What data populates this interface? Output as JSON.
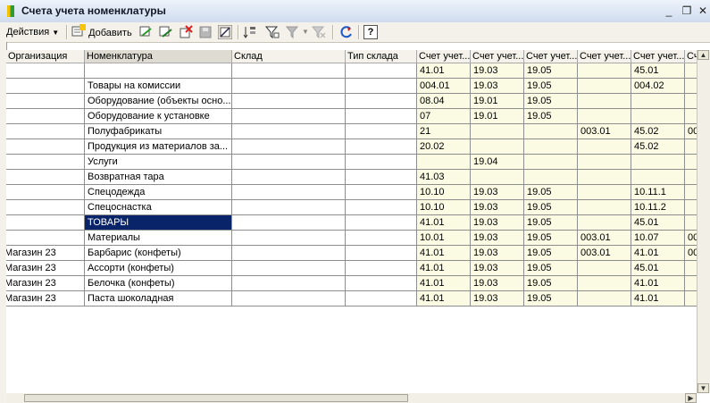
{
  "window": {
    "title": "Счета учета номенклатуры",
    "minimize": "_",
    "restore": "❐",
    "close": "✕"
  },
  "toolbar": {
    "actions_label": "Действия",
    "add_label": "Добавить",
    "help_label": "?"
  },
  "columns": [
    "Организация",
    "Номенклатура",
    "Склад",
    "Тип склада",
    "Счет учет...",
    "Счет учет...",
    "Счет учет...",
    "Счет учет...",
    "Счет учет...",
    "Сч"
  ],
  "rows": [
    [
      "",
      "",
      "",
      "",
      "41.01",
      "19.03",
      "19.05",
      "",
      "45.01",
      ""
    ],
    [
      "",
      "Товары на комиссии",
      "",
      "",
      "004.01",
      "19.03",
      "19.05",
      "",
      "004.02",
      ""
    ],
    [
      "",
      "Оборудование (объекты осно...",
      "",
      "",
      "08.04",
      "19.01",
      "19.05",
      "",
      "",
      ""
    ],
    [
      "",
      "Оборудование к установке",
      "",
      "",
      "07",
      "19.01",
      "19.05",
      "",
      "",
      ""
    ],
    [
      "",
      "Полуфабрикаты",
      "",
      "",
      "21",
      "",
      "",
      "003.01",
      "45.02",
      "00"
    ],
    [
      "",
      "Продукция из материалов за...",
      "",
      "",
      "20.02",
      "",
      "",
      "",
      "45.02",
      ""
    ],
    [
      "",
      "Услуги",
      "",
      "",
      "",
      "19.04",
      "",
      "",
      "",
      ""
    ],
    [
      "",
      "Возвратная тара",
      "",
      "",
      "41.03",
      "",
      "",
      "",
      "",
      ""
    ],
    [
      "",
      "Спецодежда",
      "",
      "",
      "10.10",
      "19.03",
      "19.05",
      "",
      "10.11.1",
      ""
    ],
    [
      "",
      "Спецоснастка",
      "",
      "",
      "10.10",
      "19.03",
      "19.05",
      "",
      "10.11.2",
      ""
    ],
    [
      "",
      "ТОВАРЫ",
      "",
      "",
      "41.01",
      "19.03",
      "19.05",
      "",
      "45.01",
      ""
    ],
    [
      "",
      "Материалы",
      "",
      "",
      "10.01",
      "19.03",
      "19.05",
      "003.01",
      "10.07",
      "00"
    ],
    [
      "Магазин 23",
      "Барбарис (конфеты)",
      "",
      "",
      "41.01",
      "19.03",
      "19.05",
      "003.01",
      "41.01",
      "00"
    ],
    [
      "Магазин 23",
      "Ассорти (конфеты)",
      "",
      "",
      "41.01",
      "19.03",
      "19.05",
      "",
      "45.01",
      ""
    ],
    [
      "Магазин 23",
      "Белочка (конфеты)",
      "",
      "",
      "41.01",
      "19.03",
      "19.05",
      "",
      "41.01",
      ""
    ],
    [
      "Магазин 23",
      "Паста шоколадная",
      "",
      "",
      "41.01",
      "19.03",
      "19.05",
      "",
      "41.01",
      ""
    ]
  ],
  "selected_row": 10,
  "selected_col": 1
}
